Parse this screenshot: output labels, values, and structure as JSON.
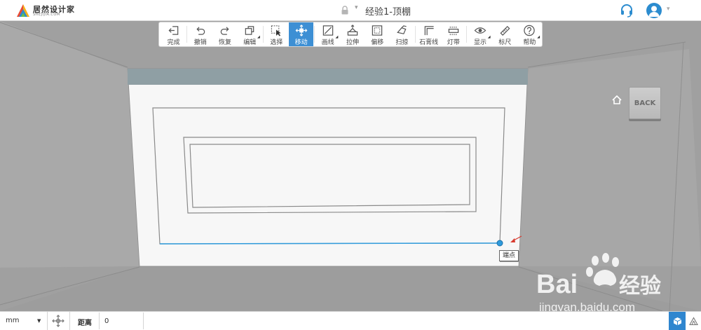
{
  "app": {
    "brand_name": "居然设计家",
    "brand_sub": "SHEJIJIA.COM",
    "document_title": "经验1-顶棚"
  },
  "toolbar": {
    "items": [
      {
        "id": "finish",
        "label": "完成",
        "icon": "exit-icon"
      },
      {
        "id": "undo",
        "label": "撤销",
        "icon": "undo-icon"
      },
      {
        "id": "redo",
        "label": "恢复",
        "icon": "redo-icon"
      },
      {
        "id": "edit",
        "label": "编辑",
        "icon": "edit-icon"
      },
      {
        "id": "select",
        "label": "选择",
        "icon": "select-icon"
      },
      {
        "id": "move",
        "label": "移动",
        "icon": "move-icon",
        "active": true
      },
      {
        "id": "draw-line",
        "label": "画线",
        "icon": "draw-line-icon"
      },
      {
        "id": "extrude",
        "label": "拉伸",
        "icon": "extrude-icon"
      },
      {
        "id": "offset",
        "label": "偏移",
        "icon": "offset-icon"
      },
      {
        "id": "sweep",
        "label": "扫掠",
        "icon": "sweep-icon"
      },
      {
        "id": "plaster-line",
        "label": "石膏线",
        "icon": "plaster-line-icon"
      },
      {
        "id": "light-strip",
        "label": "灯带",
        "icon": "light-strip-icon"
      },
      {
        "id": "display",
        "label": "显示",
        "icon": "eye-icon"
      },
      {
        "id": "ruler",
        "label": "标尺",
        "icon": "ruler-icon"
      },
      {
        "id": "help",
        "label": "帮助",
        "icon": "help-icon"
      }
    ]
  },
  "viewport": {
    "back_label": "BACK",
    "tooltip": "端点"
  },
  "statusbar": {
    "unit": "mm",
    "distance_label": "距离",
    "distance_value": "0"
  },
  "watermark": {
    "brand": "Bai",
    "brand_suffix": "经验",
    "url": "jingyan.baidu.com"
  },
  "colors": {
    "accent": "#3d8fd4",
    "selection_line": "#2f9bdc",
    "floor": "#a3a3a3",
    "ceiling_panel": "#f7f7f7",
    "wall_strip": "#8f9fa4"
  }
}
